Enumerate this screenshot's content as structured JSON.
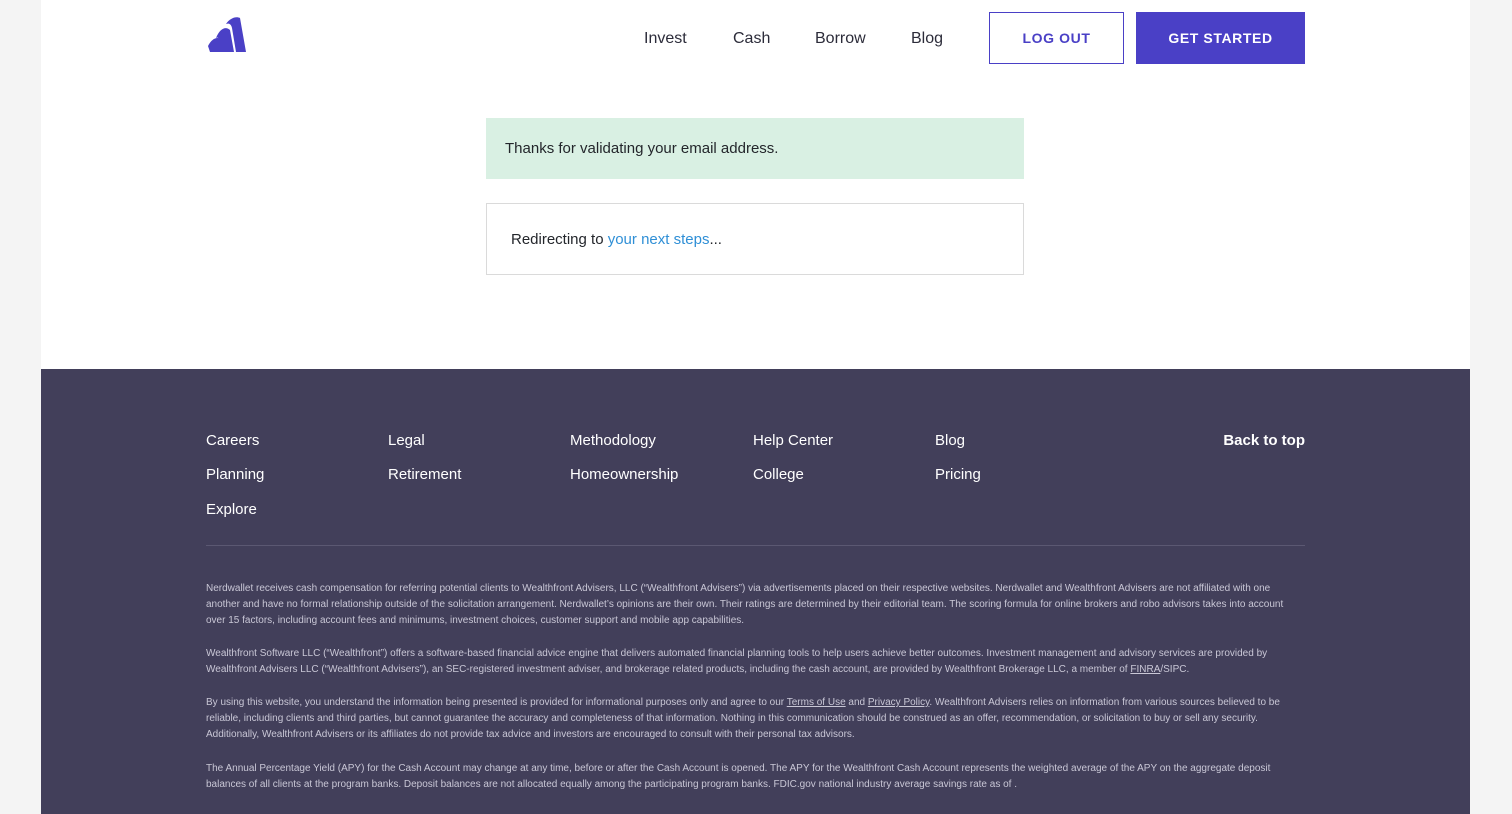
{
  "header": {
    "nav": [
      "Invest",
      "Cash",
      "Borrow",
      "Blog"
    ],
    "logout_label": "LOG OUT",
    "get_started_label": "GET STARTED",
    "logo_icon": "wealthfront-logo-icon"
  },
  "main": {
    "flash_message": "Thanks for validating your email address.",
    "redirect_prefix": "Redirecting to ",
    "redirect_link": "your next steps",
    "redirect_suffix": "..."
  },
  "footer": {
    "links": [
      "Careers",
      "Legal",
      "Methodology",
      "Help Center",
      "Blog",
      "Planning",
      "Retirement",
      "Homeownership",
      "College",
      "Pricing",
      "Explore"
    ],
    "back_to_top": "Back to top",
    "disclosure_1": "Nerdwallet receives cash compensation for referring potential clients to Wealthfront Advisers, LLC (“Wealthfront Advisers”) via advertisements placed on their respective websites. Nerdwallet and Wealthfront Advisers are not affiliated with one another and have no formal relationship outside of the solicitation arrangement. Nerdwallet’s opinions are their own. Their ratings are determined by their editorial team. The scoring formula for online brokers and robo advisors takes into account over 15 factors, including account fees and minimums, investment choices, customer support and mobile app capabilities.",
    "disclosure_2_text": "Wealthfront Software LLC (“Wealthfront”) offers a software-based financial advice engine that delivers automated financial planning tools to help users achieve better outcomes. Investment management and advisory services are provided by Wealthfront Advisers LLC (“Wealthfront Advisers”), an SEC-registered investment adviser, and brokerage related products, including the cash account, are provided by Wealthfront Brokerage LLC, a member of ",
    "disclosure_2_link": "FINRA",
    "disclosure_2_end": "/SIPC.",
    "disclosure_3_a": "By using this website, you understand the information being presented is provided for informational purposes only and agree to our ",
    "disclosure_3_terms": "Terms of Use",
    "disclosure_3_and": " and ",
    "disclosure_3_privacy": "Privacy Policy",
    "disclosure_3_b": ". Wealthfront Advisers relies on information from various sources believed to be reliable, including clients and third parties, but cannot guarantee the accuracy and completeness of that information. Nothing in this communication should be construed as an offer, recommendation, or solicitation to buy or sell any security. Additionally, Wealthfront Advisers or its affiliates do not provide tax advice and investors are encouraged to consult with their personal tax advisors.",
    "disclosure_4": "The Annual Percentage Yield (APY) for the Cash Account may change at any time, before or after the Cash Account is opened. The APY for the Wealthfront Cash Account represents the weighted average of the APY on the aggregate deposit balances of all clients at the program banks. Deposit balances are not allocated equally among the participating program banks. FDIC.gov national industry average savings rate as of ."
  },
  "colors": {
    "brand": "#4a40c6",
    "footer_bg": "#423f5a",
    "flash_bg": "#d9f0e3",
    "link": "#2f8fd6"
  }
}
